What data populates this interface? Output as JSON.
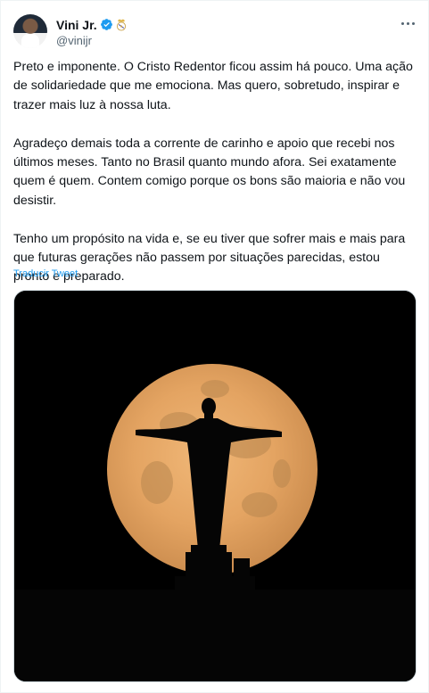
{
  "author": {
    "display_name": "Vini Jr.",
    "handle": "@vinijr",
    "verified_icon": "verified-badge-icon",
    "affiliate_icon": "club-crest-icon",
    "accent_color": "#1d9bf0"
  },
  "tweet": {
    "paragraphs": [
      "Preto e imponente. O Cristo Redentor ficou assim há pouco. Uma ação de solidariedade que me emociona. Mas quero, sobretudo, inspirar e trazer mais luz à nossa luta.",
      "Agradeço demais toda a corrente de carinho e apoio que recebi nos últimos meses. Tanto no Brasil quanto mundo afora. Sei exatamente quem é quem. Contem comigo porque os bons são maioria e não vou desistir.",
      "Tenho um propósito na vida e, se eu tiver que sofrer mais e mais para que futuras gerações não passem por situações parecidas, estou pronto e preparado."
    ],
    "translate_label": "Traducir Tweet"
  },
  "media": {
    "description_icon": "christ-redeemer-moon-photo",
    "moon_color": "#e8a866",
    "background_color": "#000000"
  }
}
